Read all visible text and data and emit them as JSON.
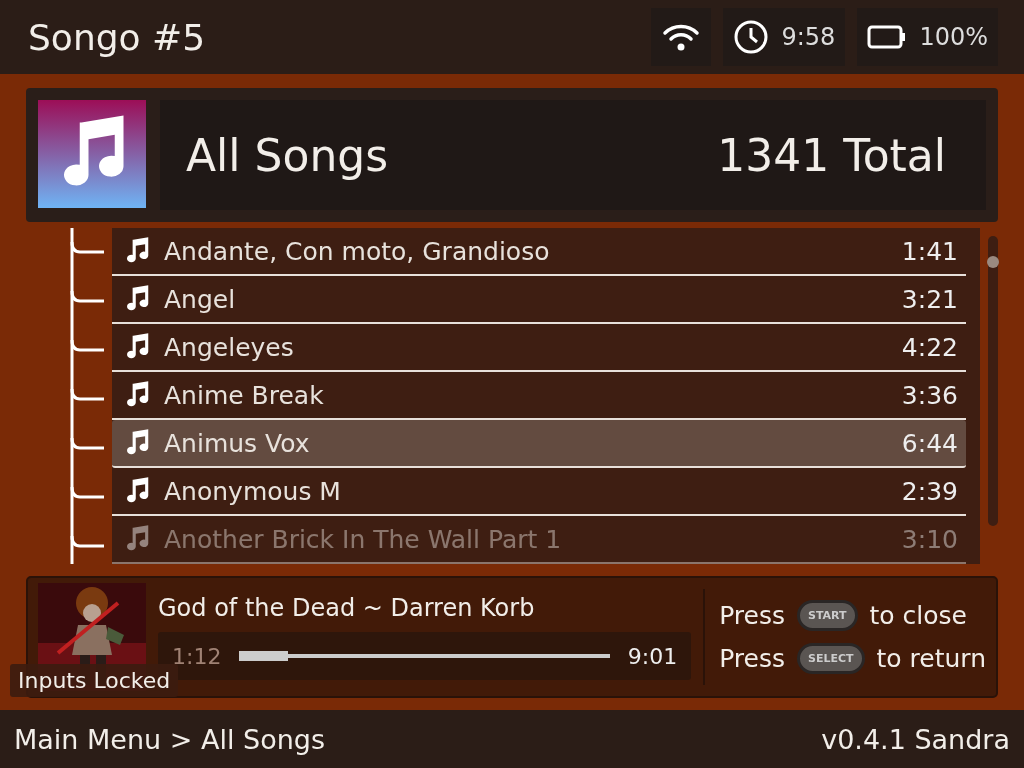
{
  "status_bar": {
    "title": "Songo #5",
    "time": "9:58",
    "battery": "100%"
  },
  "header": {
    "title": "All Songs",
    "count": "1341 Total"
  },
  "songs": [
    {
      "title": "Andante, Con moto, Grandioso",
      "duration": "1:41",
      "selected": false
    },
    {
      "title": "Angel",
      "duration": "3:21",
      "selected": false
    },
    {
      "title": "Angeleyes",
      "duration": "4:22",
      "selected": false
    },
    {
      "title": "Anime Break",
      "duration": "3:36",
      "selected": false
    },
    {
      "title": "Animus Vox",
      "duration": "6:44",
      "selected": true
    },
    {
      "title": "Anonymous M",
      "duration": "2:39",
      "selected": false
    },
    {
      "title": "Another Brick In The Wall Part 1",
      "duration": "3:10",
      "selected": false
    }
  ],
  "now_playing": {
    "track": "God of the Dead ~ Darren Korb",
    "elapsed": "1:12",
    "total": "9:01",
    "level": 0.13
  },
  "hints": [
    {
      "press": "Press",
      "key": "START",
      "action": "to close"
    },
    {
      "press": "Press",
      "key": "SELECT",
      "action": "to return"
    }
  ],
  "toast": "Inputs Locked",
  "footer": {
    "breadcrumb": "Main Menu > All Songs",
    "version": "v0.4.1 Sandra"
  }
}
